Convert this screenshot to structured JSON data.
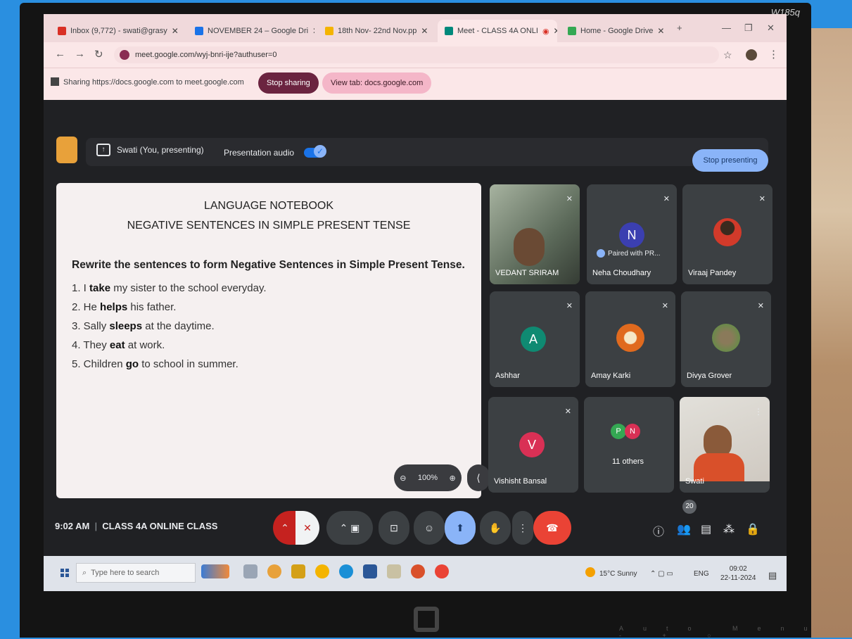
{
  "monitor": {
    "brand_tag": "W185q",
    "stand_logo": "C",
    "buttons": "Auto Menu - + ○"
  },
  "browser": {
    "tabs": [
      {
        "label": "Inbox (9,772) - swati@grasy",
        "icon_color": "#d93025"
      },
      {
        "label": "NOVEMBER 24 – Google Dri",
        "icon_color": "#1a73e8"
      },
      {
        "label": "18th Nov- 22nd Nov.pp",
        "icon_color": "#f4b400"
      },
      {
        "label": "Meet - CLASS 4A ONLI",
        "icon_color": "#00897b"
      },
      {
        "label": "Home - Google Drive",
        "icon_color": "#34a853"
      }
    ],
    "new_tab": "+",
    "url": "meet.google.com/wyj-bnri-ije?authuser=0",
    "share_notice": "Sharing https://docs.google.com to meet.google.com",
    "stop_sharing_label": "Stop sharing",
    "view_tab_label": "View tab: docs.google.com"
  },
  "meet": {
    "presenter_label": "Swati (You, presenting)",
    "presentation_audio_label": "Presentation audio",
    "stop_presenting_label": "Stop presenting",
    "zoom_level": "100%",
    "clock": "9:02 AM",
    "meeting_name": "CLASS 4A ONLINE CLASS",
    "participant_count": "20",
    "participants": [
      {
        "name": "VEDANT SRIRAM",
        "type": "video"
      },
      {
        "name": "Neha Choudhary",
        "initial": "N",
        "avatar_color": "#3b3fb0",
        "paired": "Paired with PR..."
      },
      {
        "name": "Viraaj Pandey",
        "type": "photo"
      },
      {
        "name": "Ashhar",
        "initial": "A",
        "avatar_color": "#0f8a72"
      },
      {
        "name": "Amay Karki",
        "type": "photo"
      },
      {
        "name": "Divya Grover",
        "type": "photo"
      },
      {
        "name": "Vishisht Bansal",
        "initial": "V",
        "avatar_color": "#d93055"
      },
      {
        "name": "11 others",
        "initials": [
          "P",
          "N"
        ]
      },
      {
        "name": "Swati",
        "type": "video"
      }
    ]
  },
  "document": {
    "title": "LANGUAGE NOTEBOOK",
    "subtitle": "NEGATIVE SENTENCES IN SIMPLE PRESENT TENSE",
    "instruction": "Rewrite the sentences to form Negative Sentences in Simple Present Tense.",
    "sentences": [
      {
        "pre": "1. I ",
        "bold": "take",
        "post": " my sister to the school everyday."
      },
      {
        "pre": "2. He ",
        "bold": "helps",
        "post": " his father."
      },
      {
        "pre": "3. Sally ",
        "bold": "sleeps",
        "post": " at the daytime."
      },
      {
        "pre": "4. They ",
        "bold": "eat",
        "post": " at work."
      },
      {
        "pre": "5. Children ",
        "bold": "go",
        "post": " to school in summer."
      }
    ]
  },
  "taskbar": {
    "search_placeholder": "Type here to search",
    "weather": "15°C Sunny",
    "language": "ENG",
    "time": "09:02",
    "date": "22-11-2024"
  }
}
